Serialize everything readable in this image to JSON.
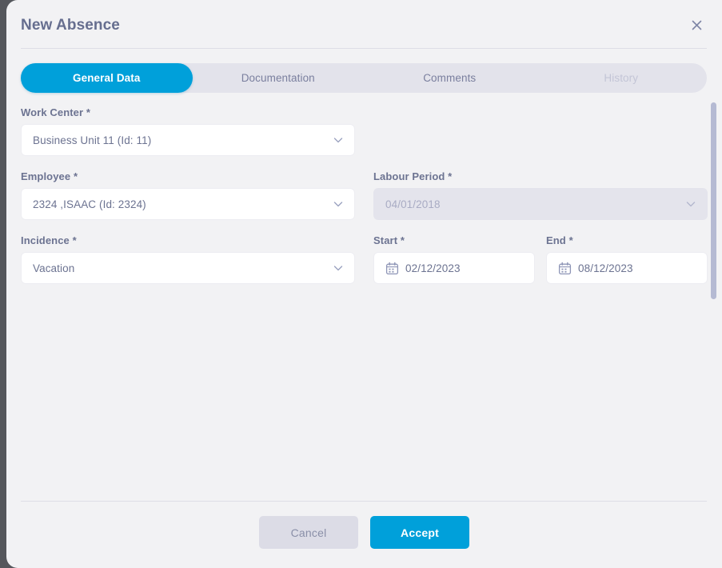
{
  "modal": {
    "title": "New Absence",
    "close_icon": "close-icon"
  },
  "tabs": [
    {
      "label": "General Data",
      "state": "active"
    },
    {
      "label": "Documentation",
      "state": "normal"
    },
    {
      "label": "Comments",
      "state": "normal"
    },
    {
      "label": "History",
      "state": "disabled"
    }
  ],
  "fields": {
    "work_center": {
      "label": "Work Center",
      "required": "*",
      "value": "Business Unit 11 (Id: 11)",
      "icon": "chevron-down-icon"
    },
    "employee": {
      "label": "Employee",
      "required": "*",
      "value": "2324 ,ISAAC (Id: 2324)",
      "icon": "chevron-down-icon"
    },
    "labour_period": {
      "label": "Labour Period",
      "required": "*",
      "value": "04/01/2018",
      "icon": "chevron-down-icon",
      "disabled": true
    },
    "incidence": {
      "label": "Incidence",
      "required": "*",
      "value": "Vacation",
      "icon": "chevron-down-icon"
    },
    "start": {
      "label": "Start",
      "required": "*",
      "value": "02/12/2023",
      "icon": "calendar-icon"
    },
    "end": {
      "label": "End",
      "required": "*",
      "value": "08/12/2023",
      "icon": "calendar-icon"
    }
  },
  "footer": {
    "cancel_label": "Cancel",
    "accept_label": "Accept"
  },
  "colors": {
    "accent": "#00A0DA",
    "label": "#6C7391",
    "tab_track": "#E3E3EB",
    "surface": "#F2F2F4",
    "disabled_field": "#E4E4EC"
  }
}
